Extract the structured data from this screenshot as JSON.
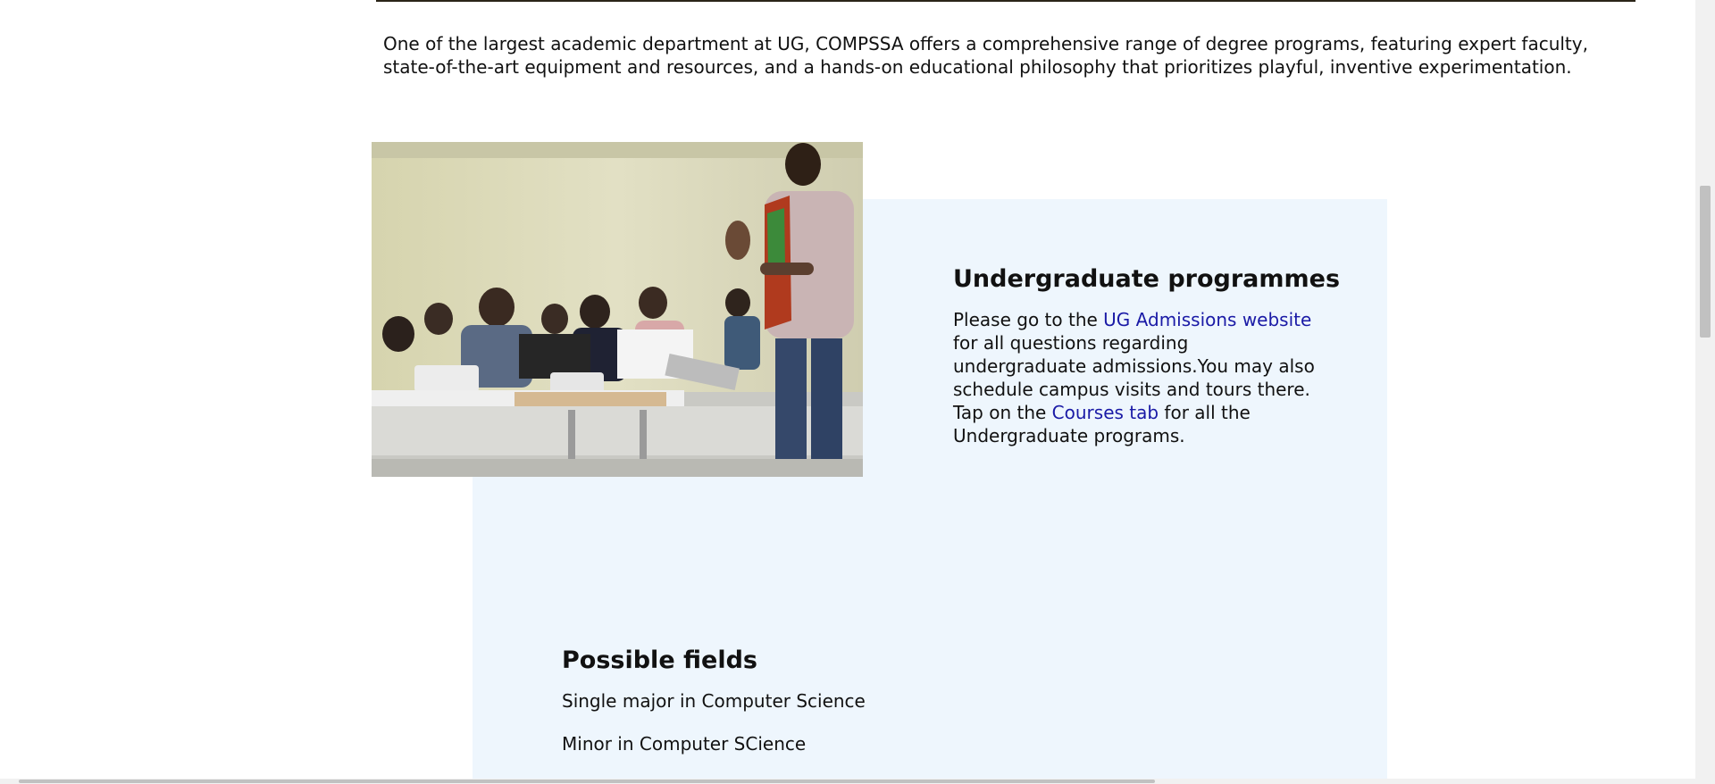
{
  "intro": {
    "text": "One of the largest academic department at UG, COMPSSA offers a comprehensive range of degree programs, featuring expert faculty, state-of-the-art equipment and resources, and a hands-on educational philosophy that prioritizes playful, inventive experimentation."
  },
  "undergraduate": {
    "title": "Undergraduate programmes",
    "text_before_link1": "Please go to the ",
    "link1": "UG Admissions website",
    "text_after_link1": " for all questions regarding undergraduate admissions.You may also schedule campus visits and tours there.",
    "text_before_link2": "Tap on the ",
    "link2": "Courses tab",
    "text_after_link2": " for all the Undergraduate programs."
  },
  "fields": {
    "title": "Possible fields",
    "items": [
      "Single major in Computer Science",
      "Minor in Computer SCience"
    ]
  },
  "colors": {
    "panel_background": "#eef6fd",
    "link": "#1a1aa6",
    "text": "#111111"
  }
}
